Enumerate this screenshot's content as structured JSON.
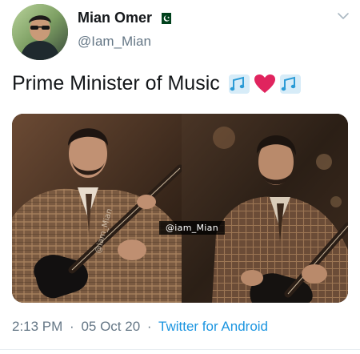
{
  "user": {
    "name": "Mian Omer",
    "handle": "@Iam_Mian",
    "flag_icon": "pakistan-flag-icon"
  },
  "tweet": {
    "text": "Prime Minister of Music",
    "emojis": [
      "notes-icon",
      "red-heart-icon",
      "notes-icon"
    ]
  },
  "media": {
    "watermark": "@iam_Mian",
    "vertical_watermark": "@iam_Mian"
  },
  "meta": {
    "time": "2:13 PM",
    "separator": "·",
    "date": "05 Oct 20",
    "source": "Twitter for Android"
  },
  "colors": {
    "text": "#14171a",
    "secondary": "#657786",
    "link": "#1b95e0",
    "heart": "#e0245e",
    "notes": "#2b9bd6"
  }
}
